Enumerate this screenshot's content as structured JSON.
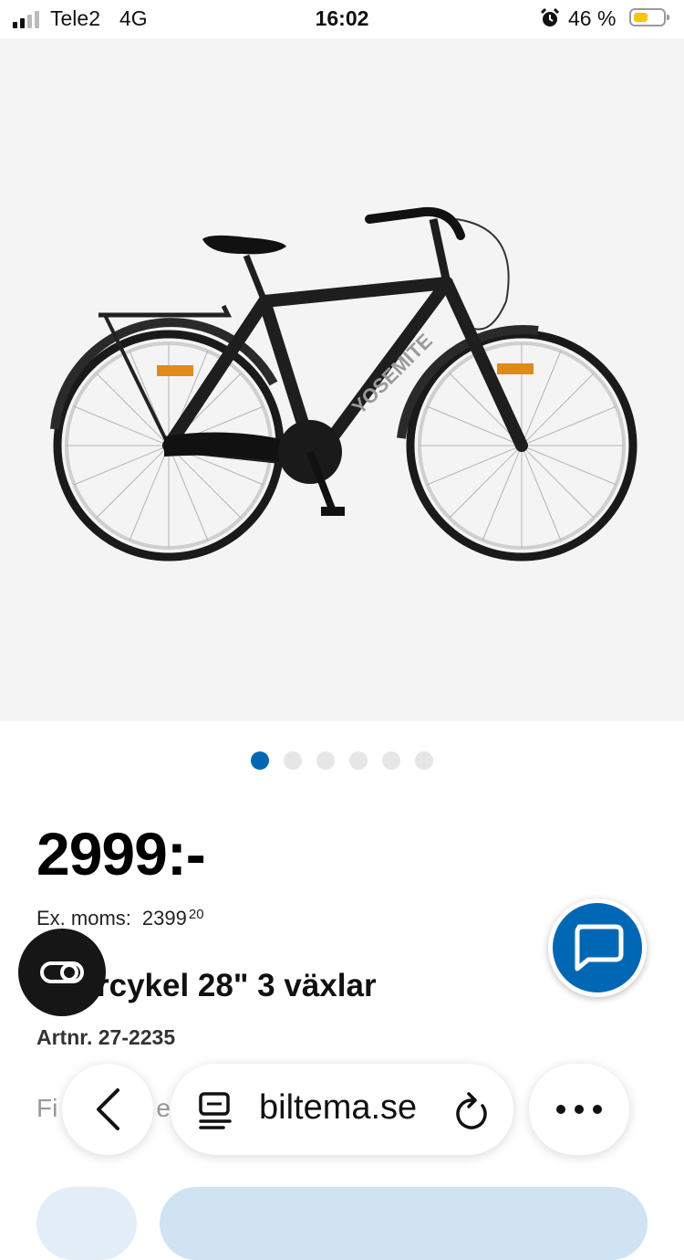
{
  "status_bar": {
    "carrier": "Tele2",
    "network": "4G",
    "time": "16:02",
    "battery_percent": "46 %",
    "battery_level": 0.46,
    "icons": [
      "signal-icon",
      "alarm-icon",
      "battery-icon"
    ]
  },
  "product": {
    "image_alt_icon": "bicycle-image",
    "image_brand_text": "YOSEMITE",
    "carousel": {
      "count": 6,
      "active_index": 0
    },
    "price": "2999:-",
    "ex_moms_label": "Ex. moms:",
    "ex_moms_value": "2399",
    "ex_moms_cents": "20",
    "title": "rcykel 28\" 3 växlar",
    "artnr": "Artnr. 27-2235",
    "find_store_text": "Fi",
    "find_store_text_2": "e"
  },
  "floating": {
    "compare_icon": "compare-link-icon",
    "chat_icon": "chat-bubble-icon"
  },
  "browser": {
    "url": "biltema.se",
    "icons": [
      "back-chevron-icon",
      "page-menu-icon",
      "reload-icon",
      "more-dots-icon"
    ]
  },
  "colors": {
    "accent": "#0067b5",
    "image_bg": "#f4f4f4",
    "battery_fill": "#f7c600"
  }
}
